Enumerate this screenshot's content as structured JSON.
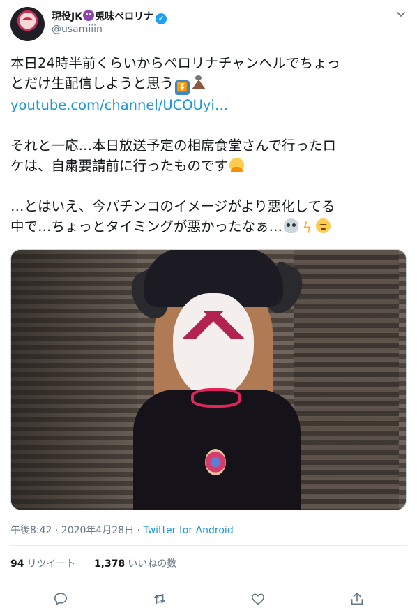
{
  "tweet": {
    "author": {
      "name_part1": "現役JK",
      "name_emoji": "smiling-imp-icon",
      "name_part2": "兎味ペロリナ",
      "handle": "@usamiiin",
      "verified": true
    },
    "text_lines": [
      "本日24時半前くらいからペロリナチャンヘルでちょっ",
      "とだけ生配信しようと思う",
      "それと一応…本日放送予定の相席食堂さんで行ったロ",
      "ケは、自粛要請前に行ったものです",
      "…とはいえ、今パチンコのイメージがより悪化してる",
      "中で…ちょっとタイミングが悪かったなぁ…"
    ],
    "link": "youtube.com/channel/UCOUyi…",
    "emojis": [
      "arrow-down-double-icon",
      "volcano-icon",
      "person-bowing-icon",
      "skull-icon",
      "zap-icon",
      "pensive-face-icon"
    ],
    "timestamp": "午後8:42 · 2020年4月28日 · ",
    "source": "Twitter for Android",
    "retweets_count": "94",
    "retweets_label": "リツイート",
    "likes_count": "1,378",
    "likes_label": "いいねの数"
  },
  "actions": [
    "reply-icon",
    "retweet-icon",
    "like-icon",
    "share-icon"
  ],
  "colors": {
    "link": "#1b95e0",
    "verified": "#1da1f2",
    "muted": "#657786"
  }
}
